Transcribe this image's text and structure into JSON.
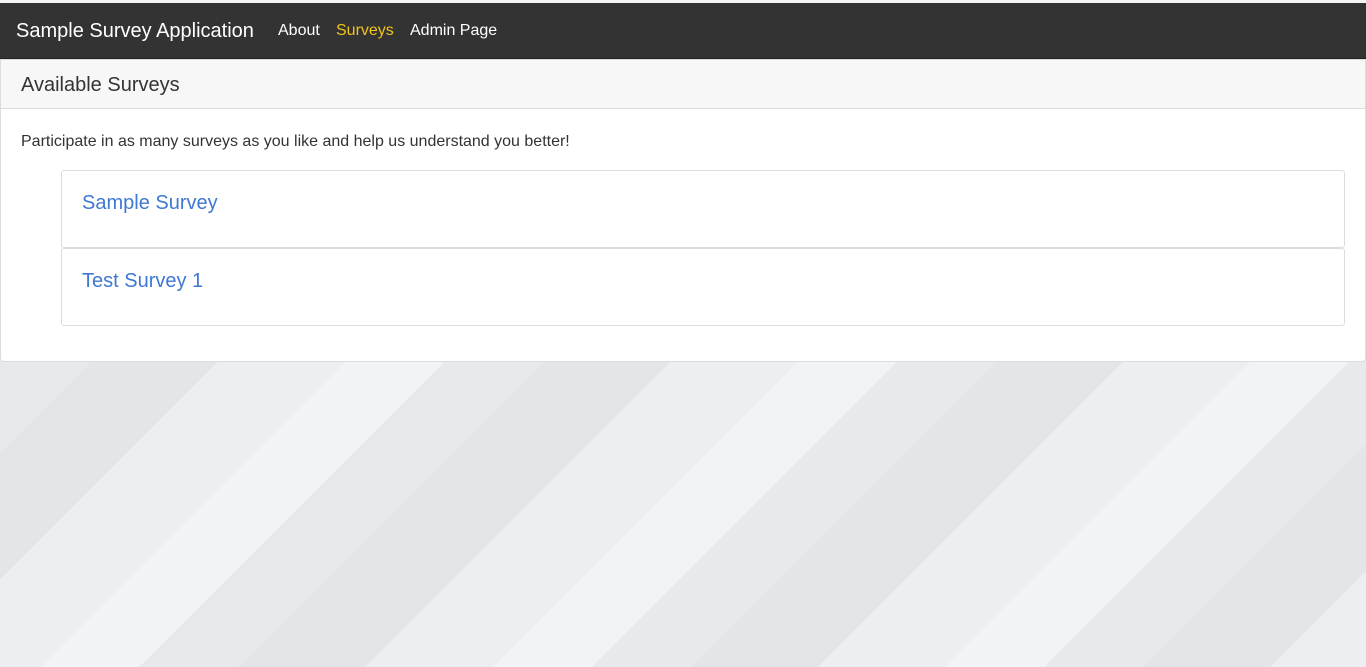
{
  "navbar": {
    "brand": "Sample Survey Application",
    "links": [
      {
        "label": "About",
        "active": false
      },
      {
        "label": "Surveys",
        "active": true
      },
      {
        "label": "Admin Page",
        "active": false
      }
    ],
    "active_color": "#f0c419",
    "background_color": "#333333"
  },
  "panel": {
    "title": "Available Surveys",
    "intro": "Participate in as many surveys as you like and help us understand you better!",
    "surveys": [
      {
        "name": "Sample Survey"
      },
      {
        "name": "Test Survey 1"
      }
    ],
    "link_color": "#3f78d2"
  }
}
